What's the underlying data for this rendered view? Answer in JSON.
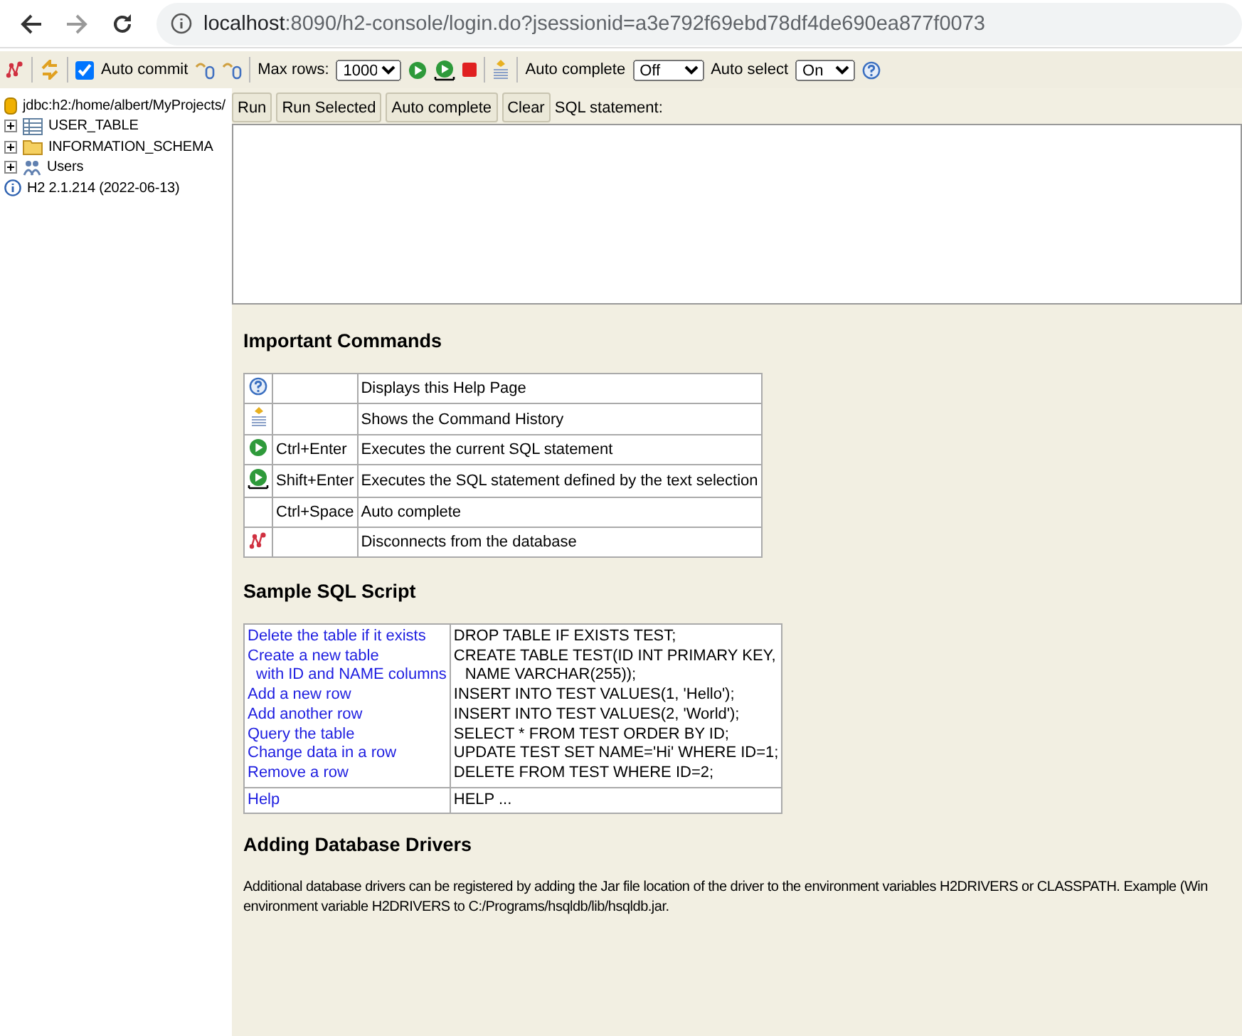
{
  "browser": {
    "url_host": "localhost",
    "url_rest": ":8090/h2-console/login.do?jsessionid=a3e792f69ebd78df4de690ea877f0073"
  },
  "toolbar": {
    "auto_commit": {
      "label": "Auto commit",
      "checked": true
    },
    "max_rows": {
      "label": "Max rows:",
      "value": "1000"
    },
    "auto_complete": {
      "label": "Auto complete",
      "value": "Off"
    },
    "auto_select": {
      "label": "Auto select",
      "value": "On"
    }
  },
  "sidebar": {
    "connection": "jdbc:h2:/home/albert/MyProjects/",
    "items": [
      {
        "kind": "table",
        "label": "USER_TABLE"
      },
      {
        "kind": "folder",
        "label": "INFORMATION_SCHEMA"
      },
      {
        "kind": "users",
        "label": "Users"
      }
    ],
    "version": "H2 2.1.214 (2022-06-13)"
  },
  "editor": {
    "buttons": [
      "Run",
      "Run Selected",
      "Auto complete",
      "Clear"
    ],
    "label": "SQL statement:"
  },
  "important_commands": {
    "title": "Important Commands",
    "rows": [
      {
        "kind": "help",
        "shortcut": "",
        "description": "Displays this Help Page"
      },
      {
        "kind": "history",
        "shortcut": "",
        "description": "Shows the Command History"
      },
      {
        "kind": "run",
        "shortcut": "Ctrl+Enter",
        "description": "Executes the current SQL statement"
      },
      {
        "kind": "run-selected",
        "shortcut": "Shift+Enter",
        "description": "Executes the SQL statement defined by the text selection"
      },
      {
        "kind": "none",
        "shortcut": "Ctrl+Space",
        "description": "Auto complete"
      },
      {
        "kind": "disconnect",
        "shortcut": "",
        "description": "Disconnects from the database"
      }
    ]
  },
  "sample_sql": {
    "title": "Sample SQL Script",
    "rows": [
      {
        "links": [
          "Delete the table if it exists",
          "Create a new table",
          "with ID and NAME columns",
          "Add a new row",
          "Add another row",
          "Query the table",
          "Change data in a row",
          "Remove a row"
        ],
        "sql": [
          "DROP TABLE IF EXISTS TEST;",
          "CREATE TABLE TEST(ID INT PRIMARY KEY,",
          "NAME VARCHAR(255));",
          "INSERT INTO TEST VALUES(1, 'Hello');",
          "INSERT INTO TEST VALUES(2, 'World');",
          "SELECT * FROM TEST ORDER BY ID;",
          "UPDATE TEST SET NAME='Hi' WHERE ID=1;",
          "DELETE FROM TEST WHERE ID=2;"
        ]
      },
      {
        "links": [
          "Help"
        ],
        "sql": [
          "HELP ..."
        ]
      }
    ]
  },
  "drivers": {
    "title": "Adding Database Drivers",
    "lines": [
      "Additional database drivers can be registered by adding the Jar file location of the driver to the environment variables H2DRIVERS or CLASSPATH. Example (Win",
      "environment variable H2DRIVERS to C:/Programs/hsqldb/lib/hsqldb.jar."
    ]
  }
}
